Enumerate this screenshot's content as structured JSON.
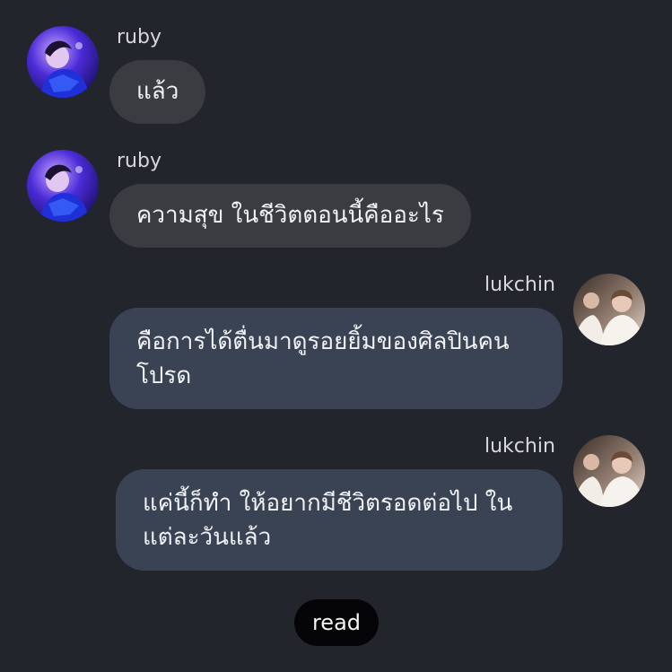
{
  "messages": [
    {
      "sender": "ruby",
      "side": "left",
      "avatar": "ruby-avatar",
      "lines": [
        "แล้ว"
      ]
    },
    {
      "sender": "ruby",
      "side": "left",
      "avatar": "ruby-avatar",
      "lines": [
        "ความสุข ในชีวิตตอนนี้คืออะไร"
      ]
    },
    {
      "sender": "lukchin",
      "side": "right",
      "avatar": "lukchin-avatar",
      "lines": [
        "คือการได้ตื่นมาดูรอยยิ้มของศิลปินคน",
        "โปรด"
      ]
    },
    {
      "sender": "lukchin",
      "side": "right",
      "avatar": "lukchin-avatar",
      "lines": [
        "แค่นี้ก็ทำ ให้อยากมีชีวิตรอดต่อไป ใน",
        "แต่ละวันแล้ว"
      ]
    }
  ],
  "status": {
    "read_label": "read"
  },
  "colors": {
    "background": "#23252d",
    "left_bubble": "#3b3c42",
    "right_bubble": "#3a4354",
    "read_pill": "#050507"
  }
}
